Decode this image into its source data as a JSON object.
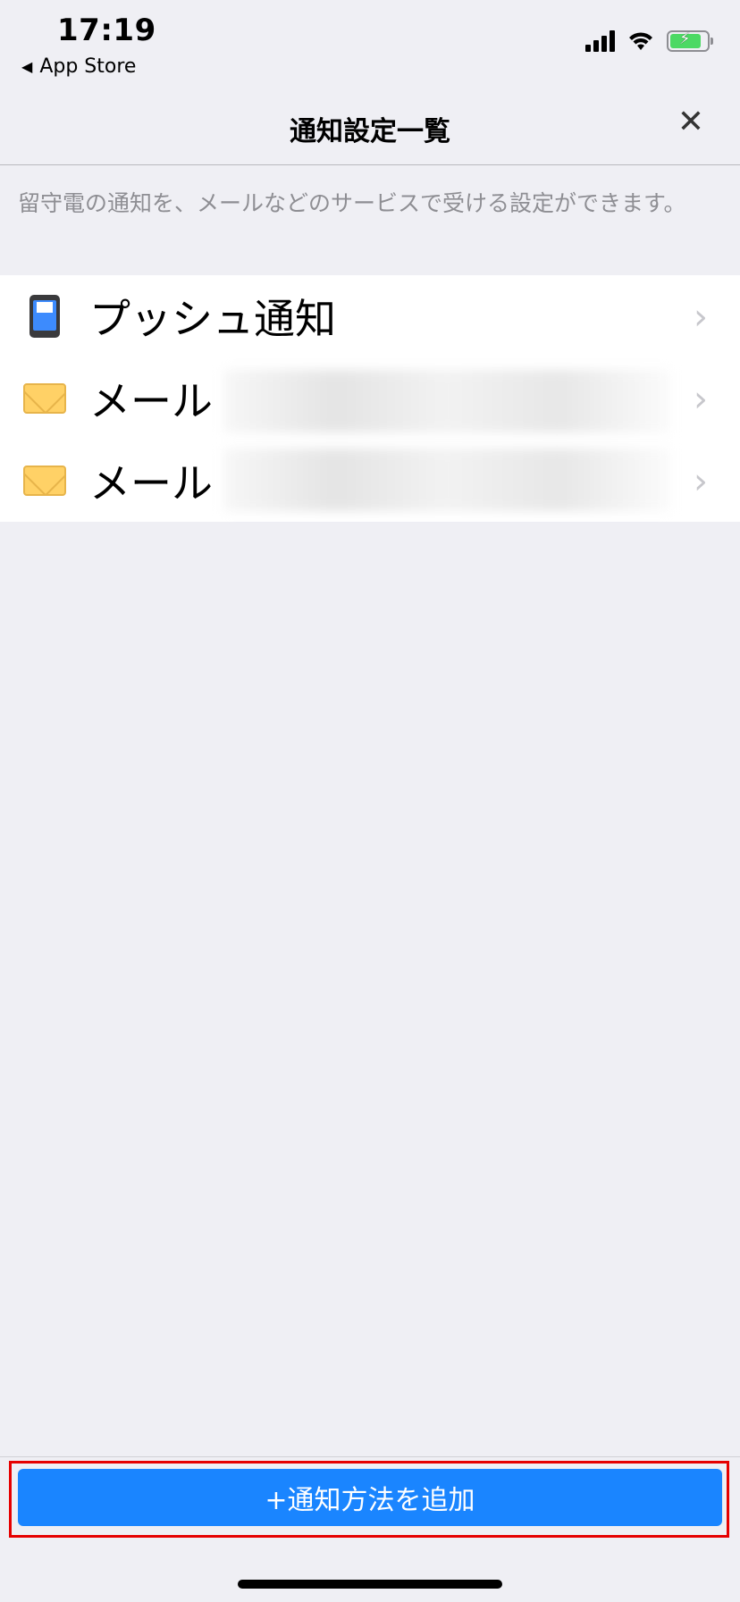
{
  "status_bar": {
    "time": "17:19",
    "back_app_label": "App Store"
  },
  "nav": {
    "title": "通知設定一覧",
    "close_glyph": "✕"
  },
  "description": "留守電の通知を、メールなどのサービスで受ける設定ができます。",
  "items": [
    {
      "label": "プッシュ通知",
      "icon": "smartphone-icon"
    },
    {
      "label": "メール",
      "icon": "envelope-icon"
    },
    {
      "label": "メール",
      "icon": "envelope-icon"
    }
  ],
  "add_button_label": "+通知方法を追加",
  "colors": {
    "accent": "#1a85ff",
    "background": "#efeff4",
    "highlight": "#e60000"
  }
}
